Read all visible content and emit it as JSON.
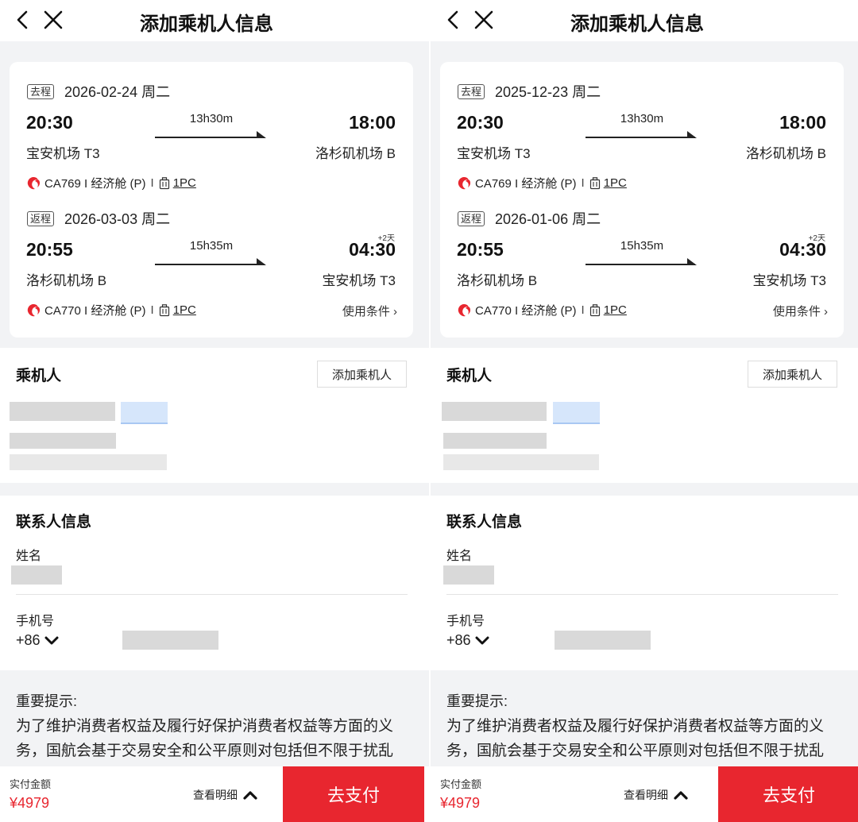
{
  "colors": {
    "brand_red": "#e8262f",
    "background": "#f2f3f5",
    "card": "#ffffff"
  },
  "panels": [
    {
      "header": {
        "title": "添加乘机人信息"
      },
      "outbound": {
        "tag": "去程",
        "date": "2026-02-24 周二",
        "dep_time": "20:30",
        "arr_time": "18:00",
        "duration": "13h30m",
        "dep_airport": "宝安机场 T3",
        "arr_airport": "洛杉矶机场 B",
        "flight_info": "CA769 I 经济舱 (P)",
        "separator": "I",
        "baggage": "1PC"
      },
      "return": {
        "tag": "返程",
        "date": "2026-03-03 周二",
        "dep_time": "20:55",
        "arr_time": "04:30",
        "plus_day": "+2天",
        "duration": "15h35m",
        "dep_airport": "洛杉矶机场 B",
        "arr_airport": "宝安机场 T3",
        "flight_info": "CA770 I 经济舱 (P)",
        "separator": "I",
        "baggage": "1PC",
        "conditions": "使用条件 ›"
      },
      "passengers": {
        "title": "乘机人",
        "add_button": "添加乘机人"
      },
      "contact": {
        "title": "联系人信息",
        "name_label": "姓名",
        "phone_label": "手机号",
        "country_code": "+86"
      },
      "notice": {
        "title": "重要提示:",
        "text": "为了维护消费者权益及履行好保护消费者权益等方面的义务，国航会基于交易安全和公平原则对包括但不限于扰乱"
      },
      "footer": {
        "amount_label": "实付金额",
        "amount": "¥4979",
        "detail_link": "查看明细",
        "pay_button": "去支付"
      }
    },
    {
      "header": {
        "title": "添加乘机人信息"
      },
      "outbound": {
        "tag": "去程",
        "date": "2025-12-23 周二",
        "dep_time": "20:30",
        "arr_time": "18:00",
        "duration": "13h30m",
        "dep_airport": "宝安机场 T3",
        "arr_airport": "洛杉矶机场 B",
        "flight_info": "CA769 I 经济舱 (P)",
        "separator": "I",
        "baggage": "1PC"
      },
      "return": {
        "tag": "返程",
        "date": "2026-01-06 周二",
        "dep_time": "20:55",
        "arr_time": "04:30",
        "plus_day": "+2天",
        "duration": "15h35m",
        "dep_airport": "洛杉矶机场 B",
        "arr_airport": "宝安机场 T3",
        "flight_info": "CA770 I 经济舱 (P)",
        "separator": "I",
        "baggage": "1PC",
        "conditions": "使用条件 ›"
      },
      "passengers": {
        "title": "乘机人",
        "add_button": "添加乘机人"
      },
      "contact": {
        "title": "联系人信息",
        "name_label": "姓名",
        "phone_label": "手机号",
        "country_code": "+86"
      },
      "notice": {
        "title": "重要提示:",
        "text": "为了维护消费者权益及履行好保护消费者权益等方面的义务，国航会基于交易安全和公平原则对包括但不限于扰乱"
      },
      "footer": {
        "amount_label": "实付金额",
        "amount": "¥4979",
        "detail_link": "查看明细",
        "pay_button": "去支付"
      }
    }
  ]
}
